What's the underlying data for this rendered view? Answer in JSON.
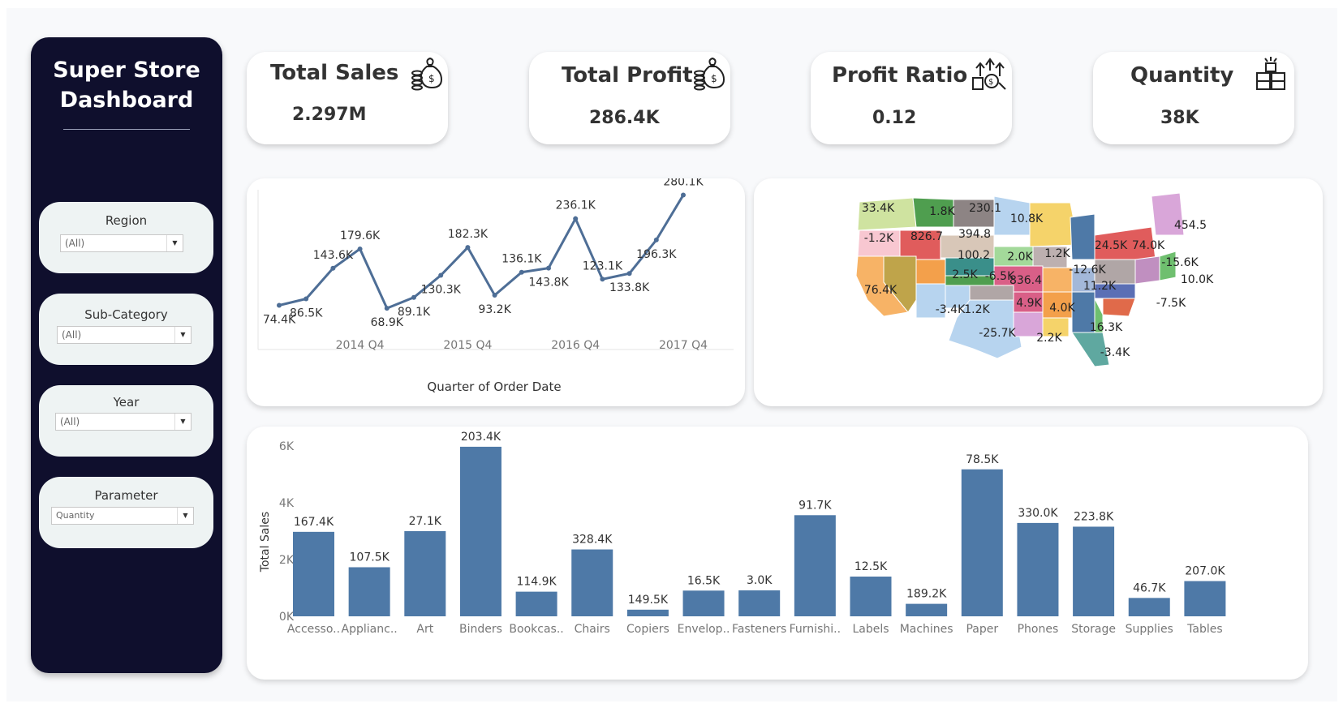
{
  "sidebar": {
    "title_line1": "Super Store",
    "title_line2": "Dashboard",
    "filters": [
      {
        "label": "Region",
        "value": "(All)"
      },
      {
        "label": "Sub-Category",
        "value": "(All)"
      },
      {
        "label": "Year",
        "value": "(All)"
      },
      {
        "label": "Parameter",
        "value": "Quantity"
      }
    ]
  },
  "kpis": [
    {
      "title": "Total Sales",
      "value": "2.297M",
      "icon": "money-bags-icon"
    },
    {
      "title": "Total Profit",
      "value": "286.4K",
      "icon": "money-bags-icon"
    },
    {
      "title": "Profit Ratio",
      "value": "0.12",
      "icon": "growth-coins-icon"
    },
    {
      "title": "Quantity",
      "value": "38K",
      "icon": "boxes-icon"
    }
  ],
  "colors": {
    "sidebar_bg": "#0f0f2d",
    "series": "#4e79a7",
    "filter_card": "#eef3f3"
  },
  "map": {
    "labels": [
      "33.4K",
      "1.8K",
      "230.1",
      "10.8K",
      "-1.2K",
      "826.7",
      "394.8",
      "454.5",
      "100.2",
      "24.5K",
      "74.0K",
      "2.0K",
      "1.2K",
      "-15.6K",
      "2.5K",
      "-6.5K",
      "-12.6K",
      "10.0K",
      "76.4K",
      "836.4",
      "11.2K",
      "-7.5K",
      "4.9K",
      "4.0K",
      "-3.4K",
      "1.2K",
      "16.3K",
      "-25.7K",
      "2.2K",
      "-3.4K"
    ]
  },
  "chart_data": [
    {
      "type": "line",
      "xlabel": "Quarter of Order Date",
      "x_ticks": [
        "2014 Q4",
        "2015 Q4",
        "2016 Q4",
        "2017 Q4"
      ],
      "x": [
        "2014 Q1",
        "2014 Q2",
        "2014 Q3",
        "2014 Q4",
        "2015 Q1",
        "2015 Q2",
        "2015 Q3",
        "2015 Q4",
        "2016 Q1",
        "2016 Q2",
        "2016 Q3",
        "2016 Q4",
        "2017 Q1",
        "2017 Q2",
        "2017 Q3",
        "2017 Q4"
      ],
      "values": [
        74400,
        86500,
        143600,
        179600,
        68900,
        89100,
        130300,
        182300,
        93200,
        136100,
        143800,
        236100,
        123100,
        133800,
        196300,
        280100
      ],
      "labels": [
        "74.4K",
        "86.5K",
        "143.6K",
        "179.6K",
        "68.9K",
        "89.1K",
        "130.3K",
        "182.3K",
        "93.2K",
        "136.1K",
        "143.8K",
        "236.1K",
        "123.1K",
        "133.8K",
        "196.3K",
        "280.1K"
      ],
      "grid": false
    },
    {
      "type": "bar",
      "ylabel": "Total Sales",
      "y_ticks": [
        "0K",
        "2K",
        "4K",
        "6K"
      ],
      "ylim": [
        0,
        6400
      ],
      "categories": [
        "Accesso..",
        "Applianc..",
        "Art",
        "Binders",
        "Bookcas..",
        "Chairs",
        "Copiers",
        "Envelop..",
        "Fasteners",
        "Furnishi..",
        "Labels",
        "Machines",
        "Paper",
        "Phones",
        "Storage",
        "Supplies",
        "Tables"
      ],
      "values": [
        2976,
        1729,
        3000,
        5974,
        868,
        2356,
        234,
        906,
        914,
        3563,
        1400,
        440,
        5178,
        3289,
        3158,
        647,
        1241
      ],
      "labels": [
        "167.4K",
        "107.5K",
        "27.1K",
        "203.4K",
        "114.9K",
        "328.4K",
        "149.5K",
        "16.5K",
        "3.0K",
        "91.7K",
        "12.5K",
        "189.2K",
        "78.5K",
        "330.0K",
        "223.8K",
        "46.7K",
        "207.0K"
      ],
      "grid": false
    }
  ]
}
